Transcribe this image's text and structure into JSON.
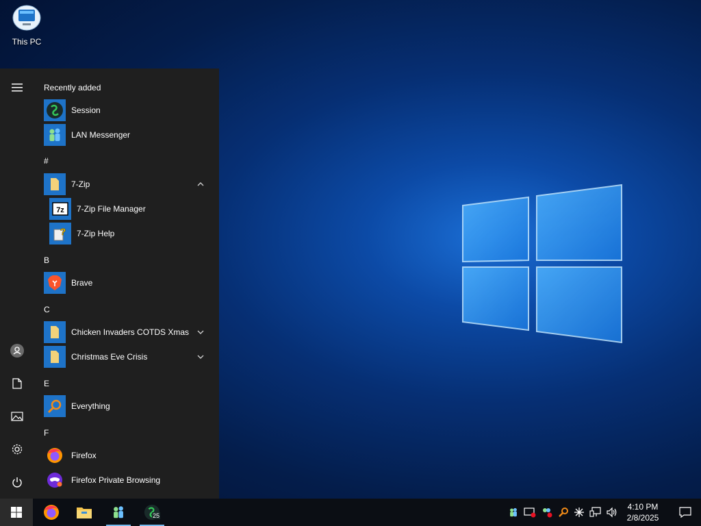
{
  "desktop": {
    "icons": [
      {
        "label": "This PC",
        "icon": "this-pc-icon"
      }
    ]
  },
  "start_menu": {
    "rail": {
      "menu_icon": "hamburger-icon",
      "user_icon": "user-icon",
      "documents_icon": "document-icon",
      "pictures_icon": "pictures-icon",
      "settings_icon": "gear-icon",
      "power_icon": "power-icon"
    },
    "groups": {
      "recent": "Recently added",
      "hash": "#",
      "b": "B",
      "c": "C",
      "e": "E",
      "f": "F"
    },
    "apps": {
      "session": "Session",
      "lan_messenger": "LAN Messenger",
      "seven_zip": "7-Zip",
      "seven_zip_fm": "7-Zip File Manager",
      "seven_zip_help": "7-Zip Help",
      "brave": "Brave",
      "chicken_invaders": "Chicken Invaders COTDS Xmas",
      "christmas_eve": "Christmas Eve Crisis",
      "everything": "Everything",
      "firefox": "Firefox",
      "firefox_private": "Firefox Private Browsing"
    }
  },
  "taskbar": {
    "start_icon": "windows-logo-icon",
    "pinned": [
      {
        "name": "firefox",
        "icon": "firefox-icon",
        "running": false
      },
      {
        "name": "file-explorer",
        "icon": "folder-icon",
        "running": false
      },
      {
        "name": "lan-messenger",
        "icon": "lan-messenger-icon",
        "running": true
      },
      {
        "name": "session",
        "icon": "session-icon",
        "running": true,
        "badge": "25"
      }
    ],
    "tray_icons": [
      "lan-messenger-tray-icon",
      "monitor-alert-icon",
      "people-error-icon",
      "search-tray-icon",
      "asterisk-icon",
      "network-icon",
      "volume-icon"
    ],
    "time": "4:10 PM",
    "date": "2/8/2025",
    "notifications_icon": "notifications-icon"
  },
  "colors": {
    "start_menu_bg": "#1f1f1f",
    "tile_blue": "#1e73c8",
    "taskbar_bg": "#0b0e14",
    "running_indicator": "#76b9ed"
  }
}
